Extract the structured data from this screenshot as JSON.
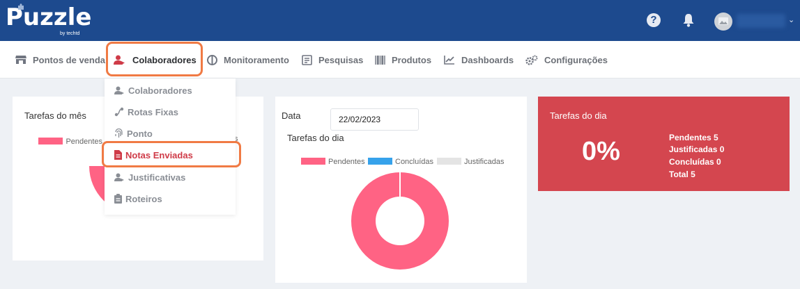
{
  "header": {
    "logo_text": "Puzzle",
    "logo_sub": "by techtd"
  },
  "nav": {
    "items": [
      {
        "label": "Pontos de venda"
      },
      {
        "label": "Colaboradores"
      },
      {
        "label": "Monitoramento"
      },
      {
        "label": "Pesquisas"
      },
      {
        "label": "Produtos"
      },
      {
        "label": "Dashboards"
      },
      {
        "label": "Configurações"
      }
    ],
    "active": "Colaboradores",
    "highlight_color": "#f07a44"
  },
  "dropdown": {
    "items": [
      {
        "label": "Colaboradores",
        "icon": "users-icon"
      },
      {
        "label": "Rotas Fixas",
        "icon": "route-icon"
      },
      {
        "label": "Ponto",
        "icon": "fingerprint-icon"
      },
      {
        "label": "Notas Enviadas",
        "icon": "document-icon"
      },
      {
        "label": "Justificativas",
        "icon": "users-icon"
      },
      {
        "label": "Roteiros",
        "icon": "clipboard-icon"
      }
    ],
    "active": "Notas Enviadas"
  },
  "card_mes": {
    "title": "Tarefas do mês",
    "legend_pendentes": "Pendentes",
    "legend_tail": "s"
  },
  "card_dia": {
    "date_label": "Data",
    "date_value": "22/02/2023",
    "title": "Tarefas do dia"
  },
  "summary": {
    "title": "Tarefas do dia",
    "percent": "0%",
    "pendentes": "Pendentes 5",
    "justificadas": "Justificadas 0",
    "concluidas": "Concluídas 0",
    "total": "Total 5",
    "color": "#d4464f"
  },
  "chart_data": {
    "type": "pie",
    "series": [
      {
        "name": "Pendentes",
        "value": 5,
        "color": "#ff6384"
      },
      {
        "name": "Concluídas",
        "value": 0,
        "color": "#36a2eb"
      },
      {
        "name": "Justificadas",
        "value": 0,
        "color": "#e4e4e4"
      }
    ],
    "legend": "top"
  }
}
